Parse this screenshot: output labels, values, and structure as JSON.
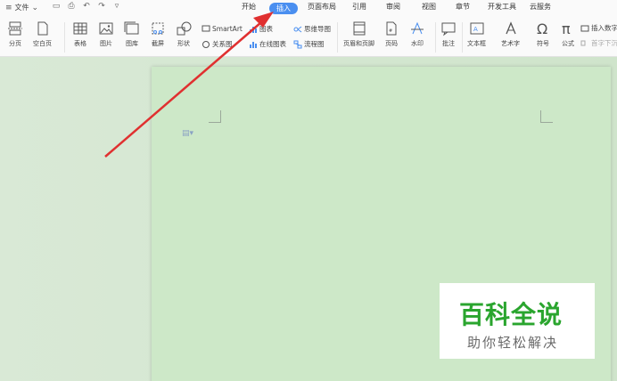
{
  "menubar": {
    "file_label": "文件",
    "tabs": [
      "开始",
      "插入",
      "页面布局",
      "引用",
      "审阅",
      "视图",
      "章节",
      "开发工具",
      "云服务"
    ],
    "active_tab": "插入"
  },
  "ribbon": {
    "page_break": "分页",
    "blank_page": "空白页",
    "table": "表格",
    "picture": "图片",
    "gallery": "图库",
    "screenshot": "截屏",
    "shape": "形状",
    "smartart": "SmartArt",
    "chart": "图表",
    "mind_map": "思维导图",
    "relation_map": "关系图",
    "online_chart": "在线图表",
    "flowchart": "流程图",
    "header_footer": "页眉和页脚",
    "page_number": "页码",
    "watermark": "水印",
    "comment": "批注",
    "textbox": "文本框",
    "wordart": "艺术字",
    "symbol": "符号",
    "formula": "公式",
    "insert_number": "插入数字",
    "dropcap": "首字下沉"
  },
  "watermark_logo": {
    "title": "百科全说",
    "subtitle": "助你轻松解决"
  },
  "colors": {
    "accent": "#4a8ff0",
    "arrow": "#e03030",
    "doc_bg": "#cde8c8",
    "logo_green": "#2aa52e"
  }
}
